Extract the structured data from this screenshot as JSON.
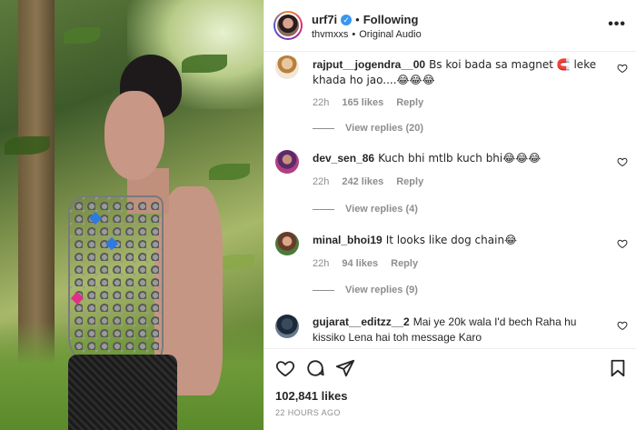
{
  "post": {
    "author": "urf7i",
    "separator": "•",
    "following_label": "Following",
    "audio_user": "thvmxxs",
    "audio_label": "Original Audio",
    "more_label": "•••"
  },
  "comments": [
    {
      "username": "rajput__jogendra__00",
      "text": "Bs koi bada sa magnet 🧲 leke khada ho jao....😂😂😂",
      "time": "22h",
      "likes": "165 likes",
      "reply_label": "Reply",
      "view_replies": "View replies (20)"
    },
    {
      "username": "dev_sen_86",
      "text": "Kuch bhi mtlb kuch bhi😂😂😂",
      "time": "22h",
      "likes": "242 likes",
      "reply_label": "Reply",
      "view_replies": "View replies (4)"
    },
    {
      "username": "minal_bhoi19",
      "text": "It looks like dog chain😂",
      "time": "22h",
      "likes": "94 likes",
      "reply_label": "Reply",
      "view_replies": "View replies (9)"
    },
    {
      "username": "gujarat__editzz__2",
      "text": "Mai ye 20k wala I'd bech Raha hu kissiko Lena hai toh message Karo"
    }
  ],
  "footer": {
    "likes_count": "102,841 likes",
    "posted_time": "22 HOURS AGO"
  },
  "icons": {
    "like": "heart-icon",
    "comment": "comment-icon",
    "share": "send-icon",
    "save": "bookmark-icon",
    "verified": "verified-badge-icon"
  },
  "colors": {
    "text": "#262626",
    "muted": "#8e8e8e",
    "verified": "#3897f0",
    "border": "#efefef"
  }
}
